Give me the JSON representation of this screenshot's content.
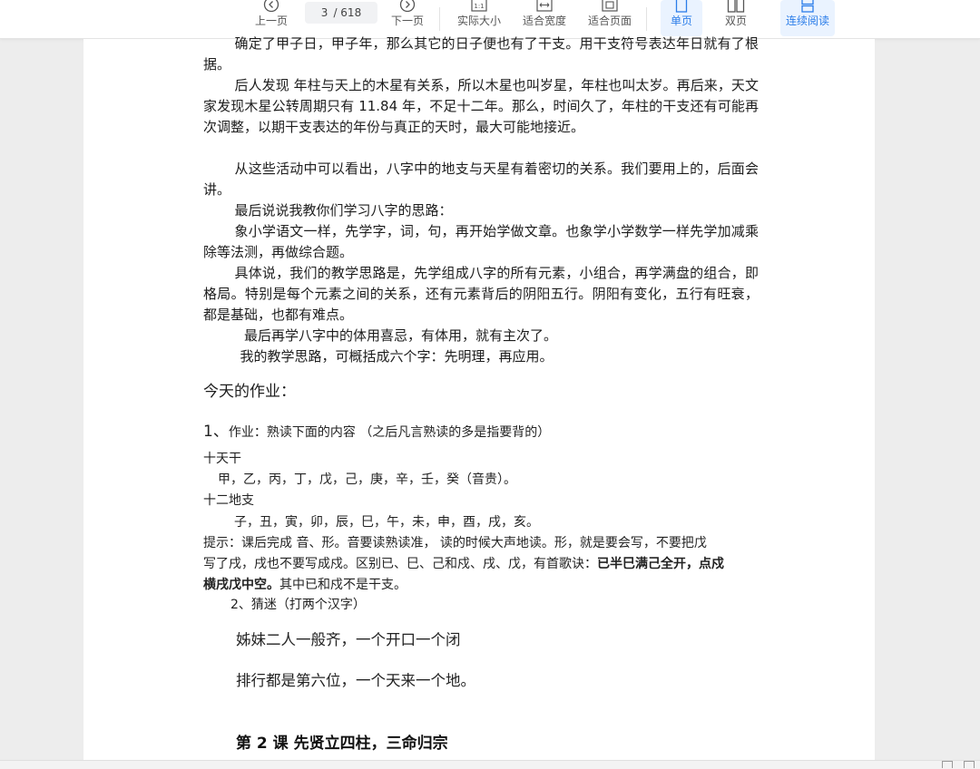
{
  "toolbar": {
    "prev_label": "上一页",
    "page_current": "3",
    "page_total": "/ 618",
    "next_label": "下一页",
    "actual_size_label": "实际大小",
    "fit_width_label": "适合宽度",
    "fit_page_label": "适合页面",
    "single_page_label": "单页",
    "double_page_label": "双页",
    "continuous_label": "连续阅读",
    "actual_size_icon_text": "1:1"
  },
  "document": {
    "paragraphs": [
      "确定了甲子日，甲子年，那么其它的日子便也有了干支。用干支符号表达年日就有了根据。",
      "后人发现  年柱与天上的木星有关系，所以木星也叫岁星，年柱也叫太岁。再后来，天文家发现木星公转周期只有 11.84 年，不足十二年。那么，时间久了，年柱的干支还有可能再次调整，以期干支表达的年份与真正的天时，最大可能地接近。",
      "从这些活动中可以看出，八字中的地支与天星有着密切的关系。我们要用上的，后面会讲。",
      "最后说说我教你们学习八字的思路：",
      "象小学语文一样，先学字，词，句，再开始学做文章。也象学小学数学一样先学加减乘除等法测，再做综合题。",
      "具体说，我们的教学思路是，先学组成八字的所有元素，小组合，再学满盘的组合，即格局。特别是每个元素之间的关系，还有元素背后的阴阳五行。阴阳有变化，五行有旺衰，都是基础，也都有难点。",
      "最后再学八字中的体用喜忌，有体用，就有主次了。",
      "我的教学思路，可概括成六个字：先明理，再应用。"
    ],
    "homework_heading": "今天的作业：",
    "hw1_number": "1、",
    "hw1_text": "作业：熟读下面的内容 （之后凡言熟读的多是指要背的）",
    "tiangan_title": "十天干",
    "tiangan_list": "甲，乙，丙，丁，戊，己，庚，辛，壬，癸（音贵）。",
    "dizhi_title": "十二地支",
    "dizhi_list": "子，丑，寅，卯，辰，巳，午，未，申，酉，戌，亥。",
    "tip_line1": "提示：课后完成  音、形。音要读熟读准，  读的时候大声地读。形，就是要会写，不要把戊",
    "tip_line2_a": "写了戌，戌也不要写成戍。区别已、巳、己和戍、戌、戊，有首歌诀：",
    "tip_line2_b": "已半巳满己全开，点戍",
    "tip_line3_a": "横戌戊中空。",
    "tip_line3_b": "其中已和戍不是干支。",
    "hw2_text": "2、猜迷（打两个汉字）",
    "riddle_1": "姊妹二人一般齐，一个开口一个闭",
    "riddle_2": "排行都是第六位，一个天来一个地。",
    "lesson_title": "第 2 课  先贤立四柱，三命归宗"
  }
}
